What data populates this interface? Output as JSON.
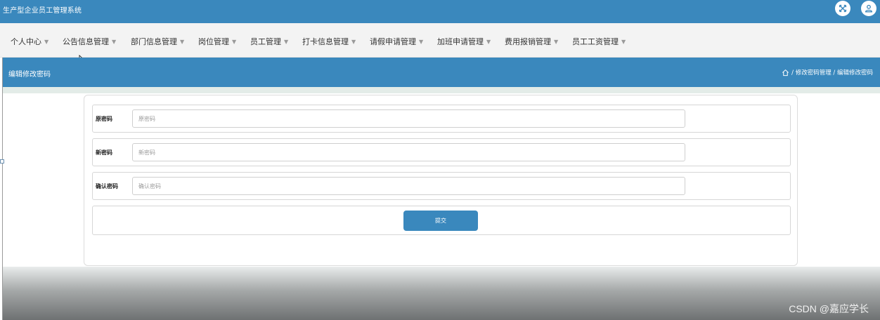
{
  "app": {
    "title": "生产型企业员工管理系统"
  },
  "topbar_icons": {
    "fullscreen": "fullscreen-icon",
    "user": "user-icon"
  },
  "nav": {
    "items": [
      {
        "label": "个人中心"
      },
      {
        "label": "公告信息管理"
      },
      {
        "label": "部门信息管理"
      },
      {
        "label": "岗位管理"
      },
      {
        "label": "员工管理"
      },
      {
        "label": "打卡信息管理"
      },
      {
        "label": "请假申请管理"
      },
      {
        "label": "加班申请管理"
      },
      {
        "label": "费用报销管理"
      },
      {
        "label": "员工工资管理"
      }
    ]
  },
  "subheader": {
    "title": "编辑修改密码",
    "breadcrumb": {
      "home_icon": "home-icon",
      "text": "/ 修改密码管理 / 编辑修改密码"
    }
  },
  "form": {
    "old_password": {
      "label": "原密码",
      "placeholder": "原密码",
      "value": ""
    },
    "new_password": {
      "label": "新密码",
      "placeholder": "新密码",
      "value": ""
    },
    "confirm_password": {
      "label": "确认密码",
      "placeholder": "确认密码",
      "value": ""
    },
    "submit_label": "提交"
  },
  "watermark": "CSDN @嘉应学长",
  "colors": {
    "primary": "#3a88bd",
    "nav_bg": "#f3f3f3",
    "strip": "#e3ece8"
  }
}
